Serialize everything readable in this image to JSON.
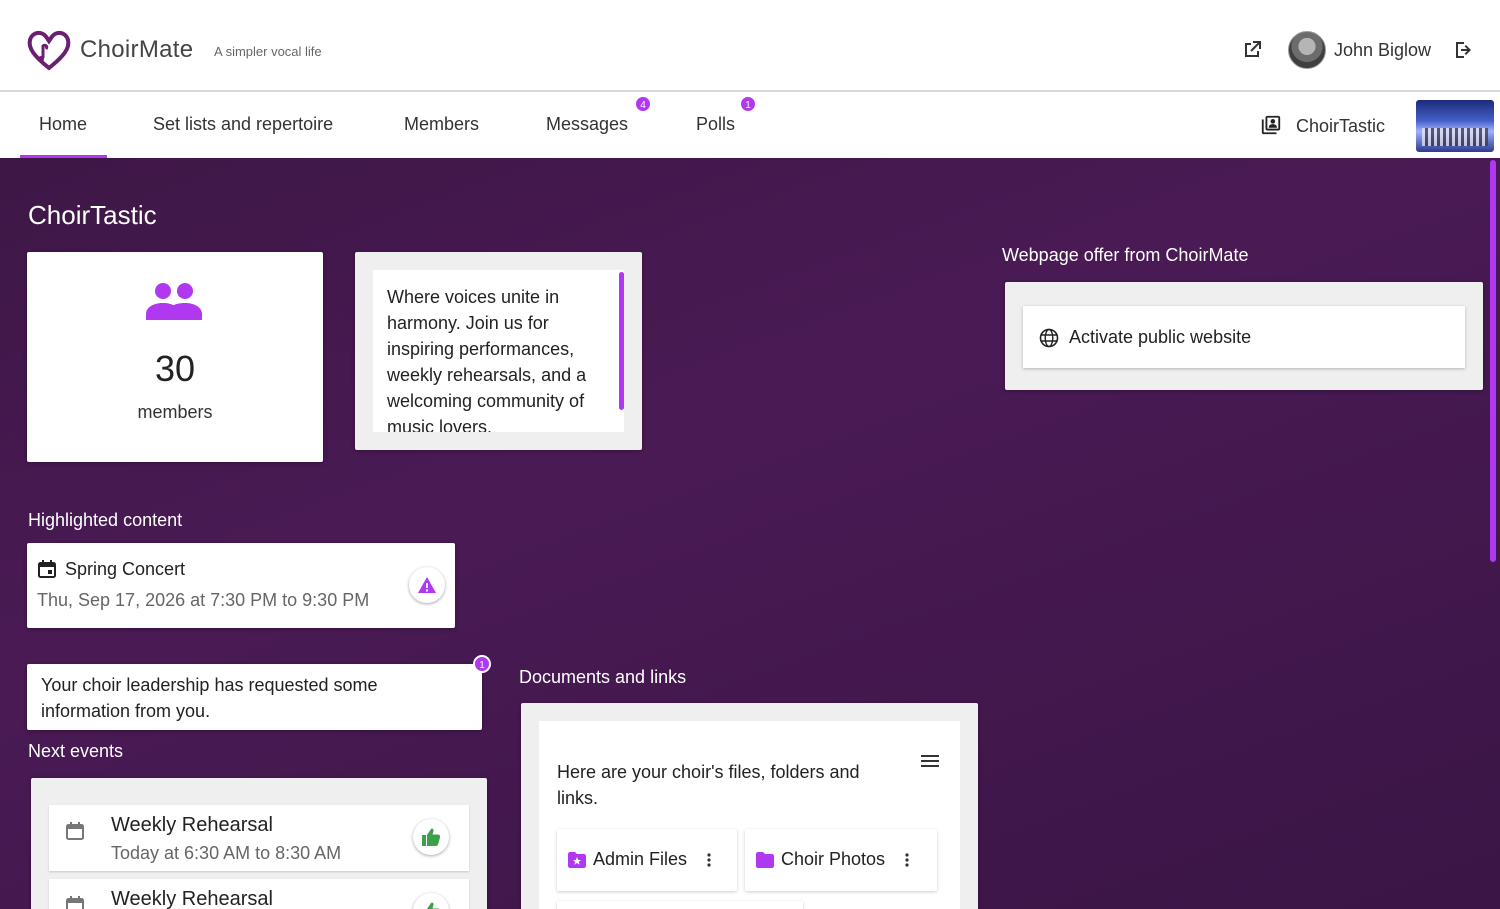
{
  "header": {
    "brand": "ChoirMate",
    "tagline": "A simpler vocal life",
    "user_name": "John Biglow"
  },
  "nav": {
    "tabs": [
      {
        "label": "Home"
      },
      {
        "label": "Set lists and repertoire"
      },
      {
        "label": "Members"
      },
      {
        "label": "Messages",
        "badge": "4"
      },
      {
        "label": "Polls",
        "badge": "1"
      }
    ],
    "choir_name": "ChoirTastic"
  },
  "main": {
    "title": "ChoirTastic",
    "members": {
      "count": "30",
      "label": "members"
    },
    "description": "Where voices unite in harmony. Join us for inspiring performances, weekly rehearsals, and a welcoming community of music lovers.",
    "webpage": {
      "heading": "Webpage offer from ChoirMate",
      "button_label": "Activate public website"
    },
    "highlighted": {
      "heading": "Highlighted content",
      "title": "Spring Concert",
      "date": "Thu, Sep 17, 2026 at 7:30 PM to 9:30 PM"
    },
    "info_request": {
      "text": "Your choir leadership has requested some information from you.",
      "badge": "1"
    },
    "next_events": {
      "heading": "Next events",
      "items": [
        {
          "title": "Weekly Rehearsal",
          "time": "Today at 6:30 AM to 8:30 AM"
        },
        {
          "title": "Weekly Rehearsal",
          "time": ""
        }
      ]
    },
    "documents": {
      "heading": "Documents and links",
      "intro": "Here are your choir's files, folders and links.",
      "items": [
        {
          "label": "Admin Files"
        },
        {
          "label": "Choir Photos"
        }
      ]
    }
  },
  "colors": {
    "accent": "#b038f0",
    "background": "#3e1746",
    "thumb_up": "#3aa14a"
  }
}
